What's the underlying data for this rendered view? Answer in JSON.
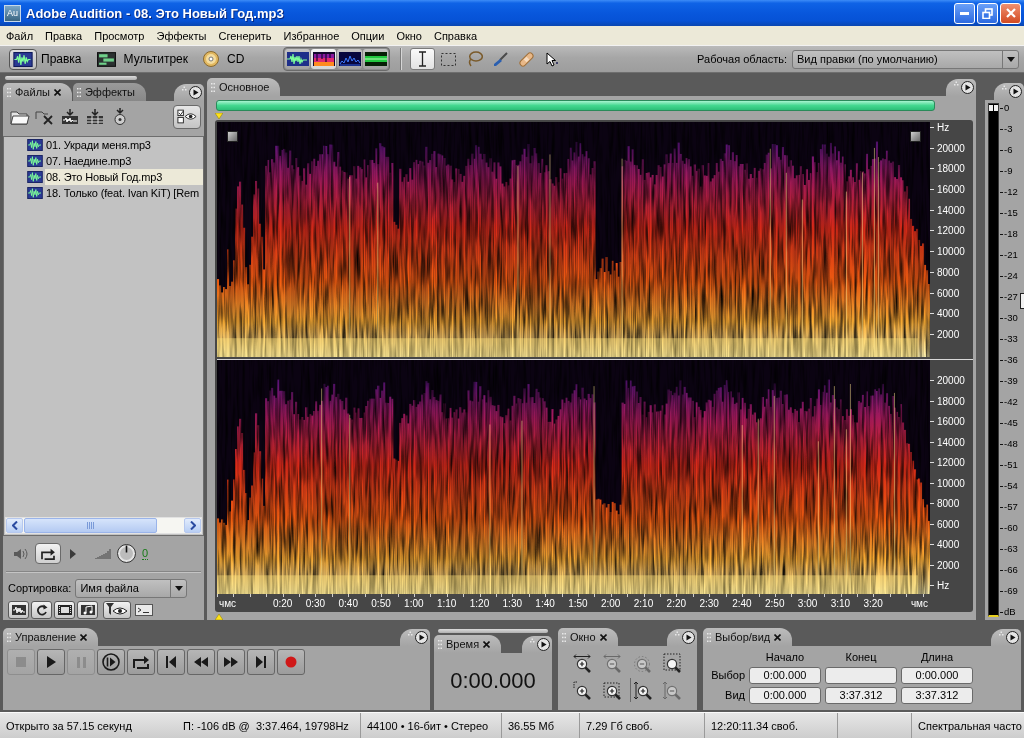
{
  "window": {
    "app_icon": "Au",
    "title": "Adobe Audition - 08. Это Новый Год.mp3"
  },
  "menu": [
    "Файл",
    "Правка",
    "Просмотр",
    "Эффекты",
    "Сгенерить",
    "Избранное",
    "Опции",
    "Окно",
    "Справка"
  ],
  "toolbar": {
    "workspaces": [
      {
        "kind": "edit",
        "label": "Правка",
        "selected": true
      },
      {
        "kind": "multitrack",
        "label": "Мультитрек",
        "selected": false
      },
      {
        "kind": "cd",
        "label": "CD",
        "selected": false
      }
    ],
    "views": [
      {
        "kind": "waveform",
        "selected": false
      },
      {
        "kind": "spectral",
        "selected": true
      },
      {
        "kind": "pan",
        "selected": false
      },
      {
        "kind": "phase",
        "selected": false
      }
    ],
    "tools": [
      {
        "kind": "time_selection",
        "selected": true
      },
      {
        "kind": "marquee",
        "selected": false
      },
      {
        "kind": "lasso",
        "selected": false
      },
      {
        "kind": "brush",
        "selected": false
      },
      {
        "kind": "healing",
        "selected": false
      },
      {
        "kind": "scrub",
        "selected": false
      }
    ],
    "workspace": {
      "label": "Рабочая область:",
      "value": "Вид правки (по умолчанию)"
    }
  },
  "files_panel": {
    "tabs": [
      {
        "label": "Файлы",
        "selected": true,
        "closable": true
      },
      {
        "label": "Эффекты",
        "selected": false,
        "closable": false
      }
    ],
    "actions": [
      {
        "kind": "open"
      },
      {
        "kind": "close"
      },
      {
        "kind": "insert_multitrack"
      },
      {
        "kind": "insert_session"
      },
      {
        "kind": "insert_cd"
      },
      {
        "kind": "view_options"
      }
    ],
    "files": [
      {
        "name": "01. Укради меня.mp3",
        "selected": false
      },
      {
        "name": "07. Наедине.mp3",
        "selected": false
      },
      {
        "name": "08. Это Новый Год.mp3",
        "selected": true
      },
      {
        "name": "18. Только (feat. Ivan KiT) [Rem",
        "selected": false
      }
    ],
    "preview": {
      "volume": "0"
    },
    "sort": {
      "label": "Сортировка:",
      "value": "Имя файла"
    },
    "filters": [
      {
        "kind": "audio"
      },
      {
        "kind": "loop"
      },
      {
        "kind": "video"
      },
      {
        "kind": "midi"
      },
      {
        "kind": "filter"
      },
      {
        "kind": "prompt"
      }
    ]
  },
  "editor": {
    "tabs": [
      {
        "label": "Основное",
        "selected": true,
        "closable": false
      }
    ],
    "channels": [
      {
        "scale": [
          "Hz",
          "20000",
          "18000",
          "16000",
          "14000",
          "12000",
          "10000",
          "8000",
          "6000",
          "4000",
          "2000"
        ]
      },
      {
        "scale": [
          "20000",
          "18000",
          "16000",
          "14000",
          "12000",
          "10000",
          "8000",
          "6000",
          "4000",
          "2000",
          "Hz"
        ]
      }
    ],
    "time_axis": [
      "чмс",
      "0:20",
      "0:30",
      "0:40",
      "0:50",
      "1:00",
      "1:10",
      "1:20",
      "1:30",
      "1:40",
      "1:50",
      "2:00",
      "2:10",
      "2:20",
      "2:30",
      "2:40",
      "2:50",
      "3:00",
      "3:10",
      "3:20",
      "чмс"
    ]
  },
  "level_meter": {
    "scale": [
      "0",
      "-3",
      "-6",
      "-9",
      "-12",
      "-15",
      "-18",
      "-21",
      "-24",
      "-27",
      "-30",
      "-33",
      "-36",
      "-39",
      "-42",
      "-45",
      "-48",
      "-51",
      "-54",
      "-57",
      "-60",
      "-63",
      "-66",
      "-69",
      "dB"
    ]
  },
  "transport": {
    "tabs": [
      {
        "label": "Управление",
        "selected": true,
        "closable": true
      }
    ],
    "buttons": [
      {
        "kind": "stop",
        "disabled": true
      },
      {
        "kind": "play",
        "disabled": false
      },
      {
        "kind": "pause",
        "disabled": true
      },
      {
        "kind": "play_to_end",
        "disabled": false
      },
      {
        "kind": "loop",
        "disabled": false
      },
      {
        "kind": "go_start",
        "disabled": false
      },
      {
        "kind": "rewind",
        "disabled": false
      },
      {
        "kind": "forward",
        "disabled": false
      },
      {
        "kind": "go_end",
        "disabled": false
      },
      {
        "kind": "record",
        "disabled": false
      }
    ]
  },
  "time_panel": {
    "tabs": [
      {
        "label": "Время",
        "selected": true,
        "closable": true
      }
    ],
    "value": "0:00.000"
  },
  "zoom_panel": {
    "tabs": [
      {
        "label": "Окно",
        "selected": true,
        "closable": true
      }
    ],
    "buttons": [
      {
        "kind": "in_horizontal",
        "disabled": false
      },
      {
        "kind": "out_horizontal",
        "disabled": true
      },
      {
        "kind": "out_full",
        "disabled": true
      },
      {
        "kind": "selection",
        "disabled": false
      },
      {
        "kind": "in_left",
        "disabled": false
      },
      {
        "kind": "in_right",
        "disabled": false
      },
      {
        "kind": "in_vertical",
        "disabled": false
      },
      {
        "kind": "out_vertical",
        "disabled": true
      }
    ]
  },
  "selection_panel": {
    "tabs": [
      {
        "label": "Выбор/вид",
        "selected": true,
        "closable": true
      }
    ],
    "columns": [
      "Начало",
      "Конец",
      "Длина"
    ],
    "rows": [
      {
        "label": "Выбор",
        "start": "0:00.000",
        "length": "0:00.000"
      },
      {
        "label": "Вид",
        "start": "0:00.000",
        "end": "3:37.312",
        "length": "3:37.312"
      }
    ]
  },
  "status_bar": {
    "open_time": "Открыто за 57.15 секунд",
    "peak": "П: -106 dB @  3:37.464, 19798Hz",
    "format": "44100 • 16-бит • Стерео",
    "size": "36.55 Мб",
    "free_space": "7.29 Гб своб.",
    "free_time": "12:20:11.34 своб.",
    "view": "Спектральная часто"
  }
}
